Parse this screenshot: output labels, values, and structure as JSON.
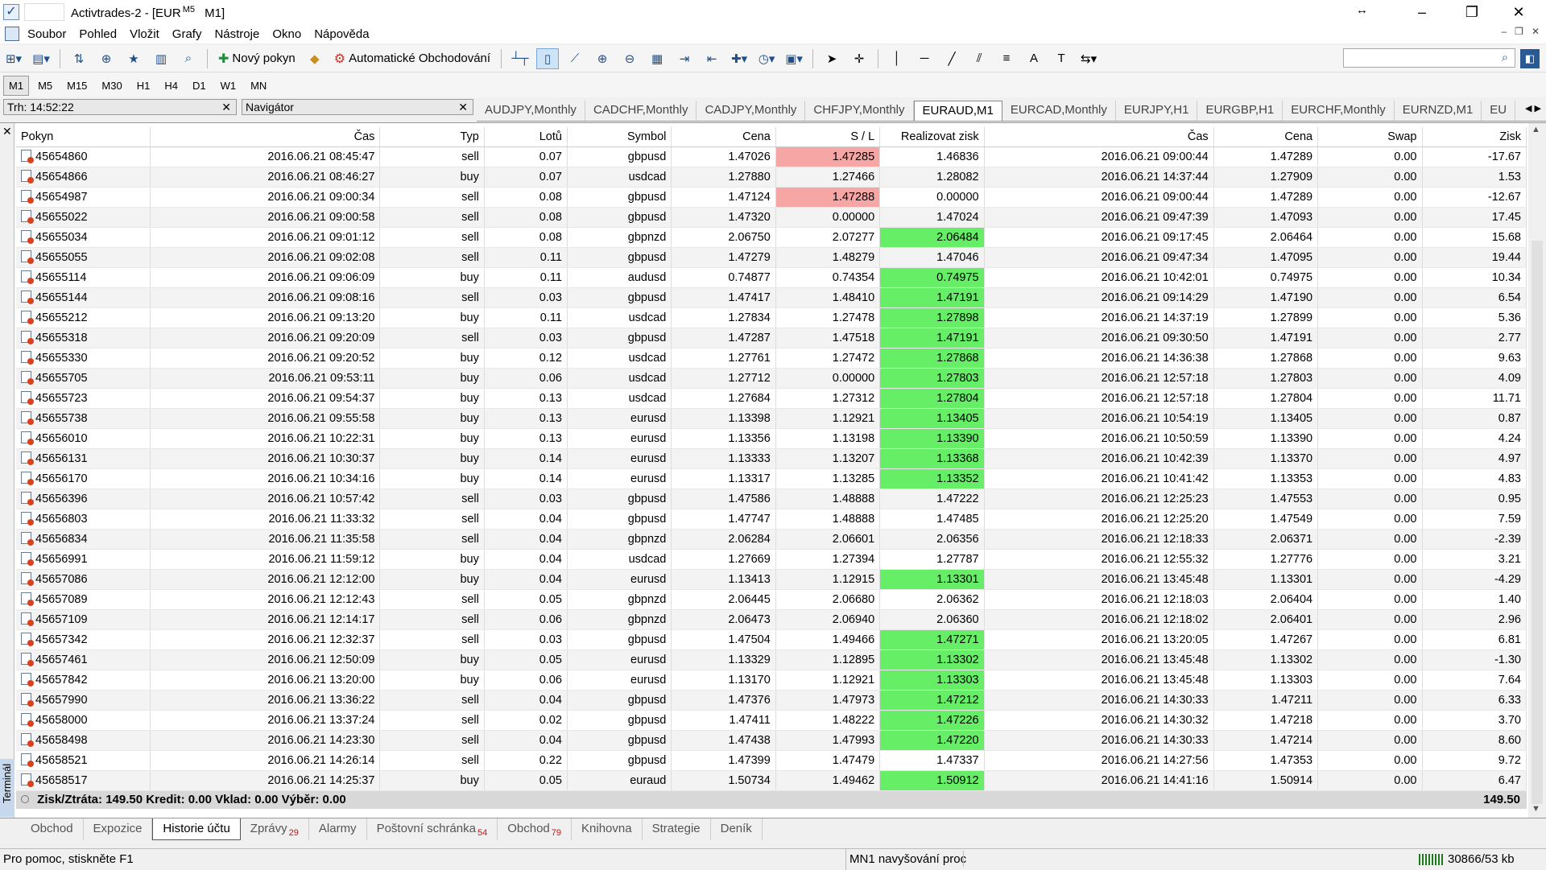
{
  "window": {
    "title": "Activtrades-2 - [EUR",
    "title_tf": "M5",
    "title_suffix": "M1]"
  },
  "menu": [
    "Soubor",
    "Pohled",
    "Vložit",
    "Grafy",
    "Nástroje",
    "Okno",
    "Nápověda"
  ],
  "toolbar": {
    "new_order": "Nový pokyn",
    "auto_trading": "Automatické Obchodování"
  },
  "timeframes": [
    "M1",
    "M5",
    "M15",
    "M30",
    "H1",
    "H4",
    "D1",
    "W1",
    "MN"
  ],
  "market_watch": {
    "title": "Trh: 14:52:22"
  },
  "navigator": {
    "title": "Navigátor"
  },
  "chart_tabs": [
    "AUDJPY,Monthly",
    "CADCHF,Monthly",
    "CADJPY,Monthly",
    "CHFJPY,Monthly",
    "EURAUD,M1",
    "EURCAD,Monthly",
    "EURJPY,H1",
    "EURGBP,H1",
    "EURCHF,Monthly",
    "EURNZD,M1",
    "EU"
  ],
  "active_chart_tab": "EURAUD,M1",
  "columns": [
    "Pokyn",
    "Čas",
    "Typ",
    "Lotů",
    "Symbol",
    "Cena",
    "S / L",
    "Realizovat zisk",
    "Čas",
    "Cena",
    "Swap",
    "Zisk"
  ],
  "rows": [
    [
      "45654860",
      "2016.06.21 08:45:47",
      "sell",
      "0.07",
      "gbpusd",
      "1.47026",
      "1.47285",
      "1.46836",
      "2016.06.21 09:00:44",
      "1.47289",
      "0.00",
      "-17.67"
    ],
    [
      "45654866",
      "2016.06.21 08:46:27",
      "buy",
      "0.07",
      "usdcad",
      "1.27880",
      "1.27466",
      "1.28082",
      "2016.06.21 14:37:44",
      "1.27909",
      "0.00",
      "1.53"
    ],
    [
      "45654987",
      "2016.06.21 09:00:34",
      "sell",
      "0.08",
      "gbpusd",
      "1.47124",
      "1.47288",
      "0.00000",
      "2016.06.21 09:00:44",
      "1.47289",
      "0.00",
      "-12.67"
    ],
    [
      "45655022",
      "2016.06.21 09:00:58",
      "sell",
      "0.08",
      "gbpusd",
      "1.47320",
      "0.00000",
      "1.47024",
      "2016.06.21 09:47:39",
      "1.47093",
      "0.00",
      "17.45"
    ],
    [
      "45655034",
      "2016.06.21 09:01:12",
      "sell",
      "0.08",
      "gbpnzd",
      "2.06750",
      "2.07277",
      "2.06484",
      "2016.06.21 09:17:45",
      "2.06464",
      "0.00",
      "15.68"
    ],
    [
      "45655055",
      "2016.06.21 09:02:08",
      "sell",
      "0.11",
      "gbpusd",
      "1.47279",
      "1.48279",
      "1.47046",
      "2016.06.21 09:47:34",
      "1.47095",
      "0.00",
      "19.44"
    ],
    [
      "45655114",
      "2016.06.21 09:06:09",
      "buy",
      "0.11",
      "audusd",
      "0.74877",
      "0.74354",
      "0.74975",
      "2016.06.21 10:42:01",
      "0.74975",
      "0.00",
      "10.34"
    ],
    [
      "45655144",
      "2016.06.21 09:08:16",
      "sell",
      "0.03",
      "gbpusd",
      "1.47417",
      "1.48410",
      "1.47191",
      "2016.06.21 09:14:29",
      "1.47190",
      "0.00",
      "6.54"
    ],
    [
      "45655212",
      "2016.06.21 09:13:20",
      "buy",
      "0.11",
      "usdcad",
      "1.27834",
      "1.27478",
      "1.27898",
      "2016.06.21 14:37:19",
      "1.27899",
      "0.00",
      "5.36"
    ],
    [
      "45655318",
      "2016.06.21 09:20:09",
      "sell",
      "0.03",
      "gbpusd",
      "1.47287",
      "1.47518",
      "1.47191",
      "2016.06.21 09:30:50",
      "1.47191",
      "0.00",
      "2.77"
    ],
    [
      "45655330",
      "2016.06.21 09:20:52",
      "buy",
      "0.12",
      "usdcad",
      "1.27761",
      "1.27472",
      "1.27868",
      "2016.06.21 14:36:38",
      "1.27868",
      "0.00",
      "9.63"
    ],
    [
      "45655705",
      "2016.06.21 09:53:11",
      "buy",
      "0.06",
      "usdcad",
      "1.27712",
      "0.00000",
      "1.27803",
      "2016.06.21 12:57:18",
      "1.27803",
      "0.00",
      "4.09"
    ],
    [
      "45655723",
      "2016.06.21 09:54:37",
      "buy",
      "0.13",
      "usdcad",
      "1.27684",
      "1.27312",
      "1.27804",
      "2016.06.21 12:57:18",
      "1.27804",
      "0.00",
      "11.71"
    ],
    [
      "45655738",
      "2016.06.21 09:55:58",
      "buy",
      "0.13",
      "eurusd",
      "1.13398",
      "1.12921",
      "1.13405",
      "2016.06.21 10:54:19",
      "1.13405",
      "0.00",
      "0.87"
    ],
    [
      "45656010",
      "2016.06.21 10:22:31",
      "buy",
      "0.13",
      "eurusd",
      "1.13356",
      "1.13198",
      "1.13390",
      "2016.06.21 10:50:59",
      "1.13390",
      "0.00",
      "4.24"
    ],
    [
      "45656131",
      "2016.06.21 10:30:37",
      "buy",
      "0.14",
      "eurusd",
      "1.13333",
      "1.13207",
      "1.13368",
      "2016.06.21 10:42:39",
      "1.13370",
      "0.00",
      "4.97"
    ],
    [
      "45656170",
      "2016.06.21 10:34:16",
      "buy",
      "0.14",
      "eurusd",
      "1.13317",
      "1.13285",
      "1.13352",
      "2016.06.21 10:41:42",
      "1.13353",
      "0.00",
      "4.83"
    ],
    [
      "45656396",
      "2016.06.21 10:57:42",
      "sell",
      "0.03",
      "gbpusd",
      "1.47586",
      "1.48888",
      "1.47222",
      "2016.06.21 12:25:23",
      "1.47553",
      "0.00",
      "0.95"
    ],
    [
      "45656803",
      "2016.06.21 11:33:32",
      "sell",
      "0.04",
      "gbpusd",
      "1.47747",
      "1.48888",
      "1.47485",
      "2016.06.21 12:25:20",
      "1.47549",
      "0.00",
      "7.59"
    ],
    [
      "45656834",
      "2016.06.21 11:35:58",
      "sell",
      "0.04",
      "gbpnzd",
      "2.06284",
      "2.06601",
      "2.06356",
      "2016.06.21 12:18:33",
      "2.06371",
      "0.00",
      "-2.39"
    ],
    [
      "45656991",
      "2016.06.21 11:59:12",
      "buy",
      "0.04",
      "usdcad",
      "1.27669",
      "1.27394",
      "1.27787",
      "2016.06.21 12:55:32",
      "1.27776",
      "0.00",
      "3.21"
    ],
    [
      "45657086",
      "2016.06.21 12:12:00",
      "buy",
      "0.04",
      "eurusd",
      "1.13413",
      "1.12915",
      "1.13301",
      "2016.06.21 13:45:48",
      "1.13301",
      "0.00",
      "-4.29"
    ],
    [
      "45657089",
      "2016.06.21 12:12:43",
      "sell",
      "0.05",
      "gbpnzd",
      "2.06445",
      "2.06680",
      "2.06362",
      "2016.06.21 12:18:03",
      "2.06404",
      "0.00",
      "1.40"
    ],
    [
      "45657109",
      "2016.06.21 12:14:17",
      "sell",
      "0.06",
      "gbpnzd",
      "2.06473",
      "2.06940",
      "2.06360",
      "2016.06.21 12:18:02",
      "2.06401",
      "0.00",
      "2.96"
    ],
    [
      "45657342",
      "2016.06.21 12:32:37",
      "sell",
      "0.03",
      "gbpusd",
      "1.47504",
      "1.49466",
      "1.47271",
      "2016.06.21 13:20:05",
      "1.47267",
      "0.00",
      "6.81"
    ],
    [
      "45657461",
      "2016.06.21 12:50:09",
      "buy",
      "0.05",
      "eurusd",
      "1.13329",
      "1.12895",
      "1.13302",
      "2016.06.21 13:45:48",
      "1.13302",
      "0.00",
      "-1.30"
    ],
    [
      "45657842",
      "2016.06.21 13:20:00",
      "buy",
      "0.06",
      "eurusd",
      "1.13170",
      "1.12921",
      "1.13303",
      "2016.06.21 13:45:48",
      "1.13303",
      "0.00",
      "7.64"
    ],
    [
      "45657990",
      "2016.06.21 13:36:22",
      "sell",
      "0.04",
      "gbpusd",
      "1.47376",
      "1.47973",
      "1.47212",
      "2016.06.21 14:30:33",
      "1.47211",
      "0.00",
      "6.33"
    ],
    [
      "45658000",
      "2016.06.21 13:37:24",
      "sell",
      "0.02",
      "gbpusd",
      "1.47411",
      "1.48222",
      "1.47226",
      "2016.06.21 14:30:32",
      "1.47218",
      "0.00",
      "3.70"
    ],
    [
      "45658498",
      "2016.06.21 14:23:30",
      "sell",
      "0.04",
      "gbpusd",
      "1.47438",
      "1.47993",
      "1.47220",
      "2016.06.21 14:30:33",
      "1.47214",
      "0.00",
      "8.60"
    ],
    [
      "45658521",
      "2016.06.21 14:26:14",
      "sell",
      "0.22",
      "gbpusd",
      "1.47399",
      "1.47479",
      "1.47337",
      "2016.06.21 14:27:56",
      "1.47353",
      "0.00",
      "9.72"
    ],
    [
      "45658517",
      "2016.06.21 14:25:37",
      "buy",
      "0.05",
      "euraud",
      "1.50734",
      "1.49462",
      "1.50912",
      "2016.06.21 14:41:16",
      "1.50914",
      "0.00",
      "6.47"
    ]
  ],
  "sl_hit_rows": [
    0,
    2
  ],
  "tp_hit_rows": [
    4,
    6,
    7,
    8,
    9,
    10,
    11,
    12,
    13,
    14,
    15,
    16,
    21,
    24,
    25,
    26,
    27,
    28,
    29,
    31
  ],
  "colors": {
    "sl_hit": "#f7a6a6",
    "tp_hit": "#66ee66"
  },
  "summary": {
    "text": "Zisk/Ztráta: 149.50  Kredit: 0.00  Vklad: 0.00  Výběr: 0.00",
    "total": "149.50"
  },
  "terminal_label": "Terminál",
  "bottom_tabs": [
    {
      "label": "Obchod",
      "badge": ""
    },
    {
      "label": "Expozice",
      "badge": ""
    },
    {
      "label": "Historie účtu",
      "badge": ""
    },
    {
      "label": "Zprávy",
      "badge": "29"
    },
    {
      "label": "Alarmy",
      "badge": ""
    },
    {
      "label": "Poštovní schránka",
      "badge": "54"
    },
    {
      "label": "Obchod",
      "badge": "79"
    },
    {
      "label": "Knihovna",
      "badge": ""
    },
    {
      "label": "Strategie",
      "badge": ""
    },
    {
      "label": "Deník",
      "badge": ""
    }
  ],
  "active_bottom_tab": 2,
  "status": {
    "help": "Pro pomoc, stiskněte F1",
    "middle": "MN1 navyšování proc",
    "connection": "30866/53 kb"
  }
}
